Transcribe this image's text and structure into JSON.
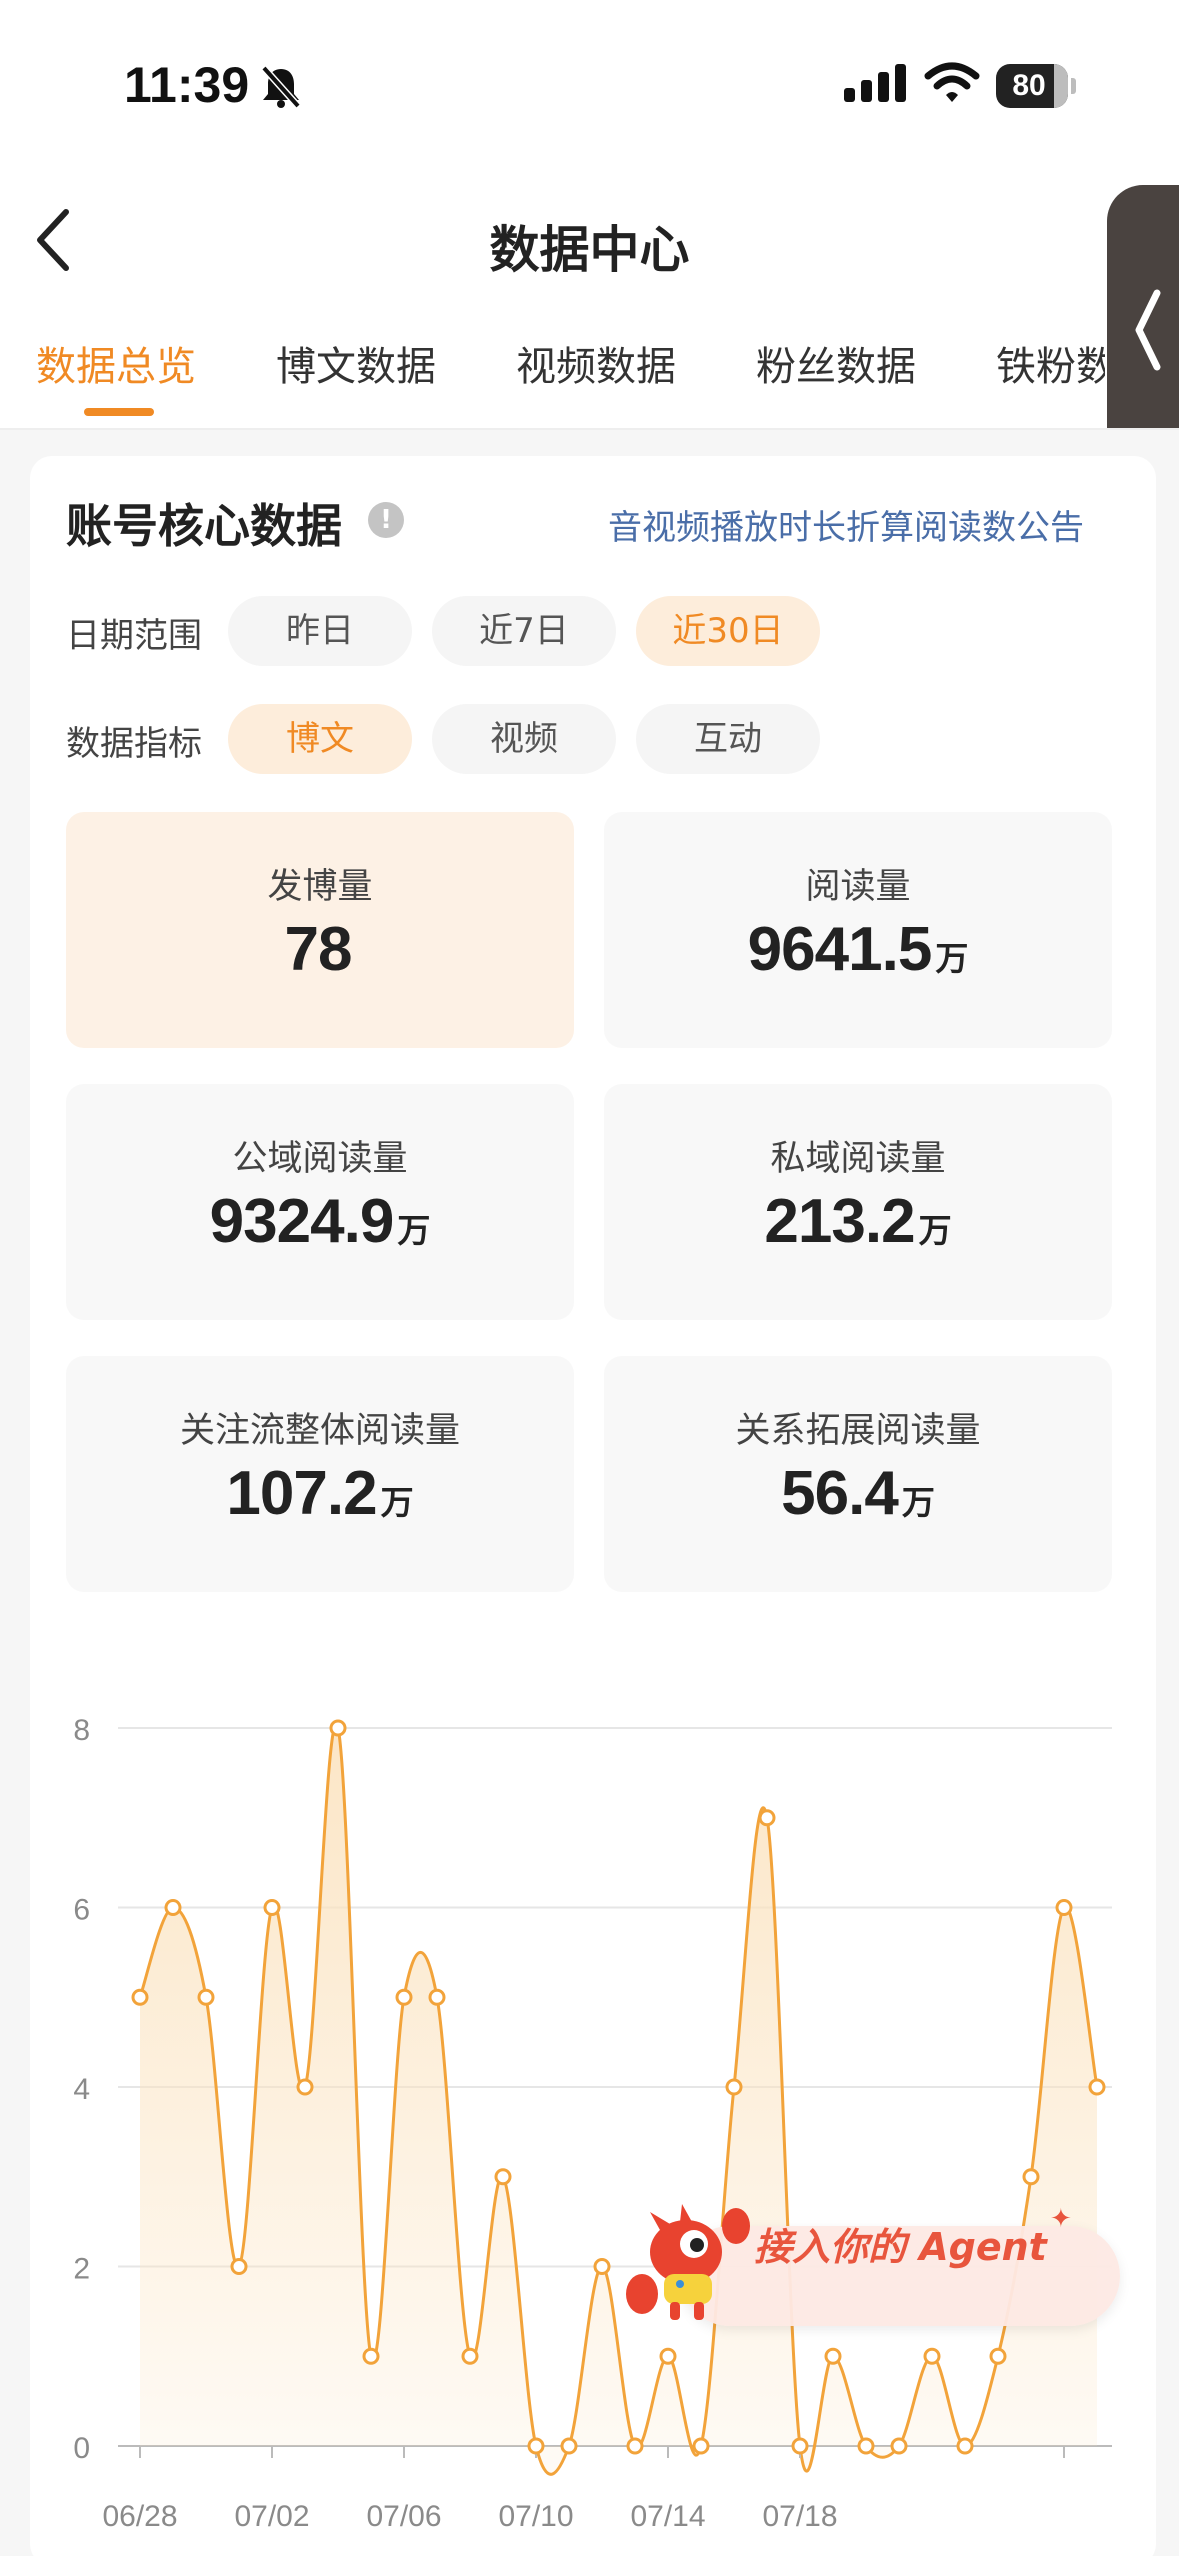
{
  "status_bar": {
    "time": "11:39",
    "battery": 80
  },
  "header": {
    "title": "数据中心"
  },
  "tabs": [
    {
      "label": "数据总览",
      "active": true
    },
    {
      "label": "博文数据",
      "active": false
    },
    {
      "label": "视频数据",
      "active": false
    },
    {
      "label": "粉丝数据",
      "active": false
    },
    {
      "label": "铁粉数",
      "active": false
    }
  ],
  "core": {
    "title": "账号核心数据",
    "info_icon": "!",
    "notice_link": "音视频播放时长折算阅读数公告",
    "date_range": {
      "label": "日期范围",
      "options": [
        "昨日",
        "近7日",
        "近30日"
      ],
      "selected": "近30日"
    },
    "metric_type": {
      "label": "数据指标",
      "options": [
        "博文",
        "视频",
        "互动"
      ],
      "selected": "博文"
    },
    "metrics": [
      {
        "label": "发博量",
        "value": "78",
        "unit": "",
        "active": true
      },
      {
        "label": "阅读量",
        "value": "9641.5",
        "unit": "万",
        "active": false
      },
      {
        "label": "公域阅读量",
        "value": "9324.9",
        "unit": "万",
        "active": false
      },
      {
        "label": "私域阅读量",
        "value": "213.2",
        "unit": "万",
        "active": false
      },
      {
        "label": "关注流整体阅读量",
        "value": "107.2",
        "unit": "万",
        "active": false
      },
      {
        "label": "关系拓展阅读量",
        "value": "56.4",
        "unit": "万",
        "active": false
      }
    ]
  },
  "chart_data": {
    "type": "area",
    "x": [
      "06/28",
      "06/29",
      "06/30",
      "07/01",
      "07/02",
      "07/03",
      "07/04",
      "07/05",
      "07/06",
      "07/07",
      "07/08",
      "07/09",
      "07/10",
      "07/11",
      "07/12",
      "07/13",
      "07/14",
      "07/15",
      "07/16",
      "07/17",
      "07/18",
      "07/19",
      "07/20",
      "07/21",
      "07/22",
      "07/23",
      "07/24",
      "07/25",
      "07/26",
      "07/27"
    ],
    "values": [
      5,
      6,
      5,
      2,
      6,
      4,
      8,
      1,
      5,
      5,
      1,
      3,
      0,
      0,
      2,
      0,
      1,
      0,
      4,
      7,
      0,
      1,
      0,
      0,
      1,
      0,
      1,
      3,
      6,
      4
    ],
    "x_tick_labels": [
      "06/28",
      "07/02",
      "07/06",
      "07/10",
      "07/14",
      "07/18"
    ],
    "ylim": [
      0,
      8
    ],
    "yticks": [
      0,
      2,
      4,
      6,
      8
    ],
    "grid": true,
    "colors": {
      "line": "#f2a33a",
      "fill": "#fbe3c0"
    }
  },
  "agent_badge": {
    "label": "接入你的 Agent",
    "spark": "✦"
  }
}
